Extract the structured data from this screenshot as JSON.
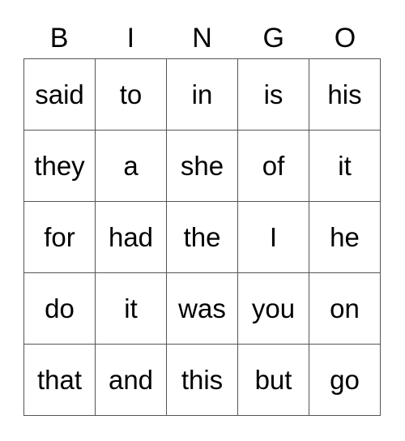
{
  "card": {
    "title": "BINGO",
    "columns": [
      "B",
      "I",
      "N",
      "G",
      "O"
    ],
    "grid": [
      [
        "said",
        "to",
        "in",
        "is",
        "his"
      ],
      [
        "they",
        "a",
        "she",
        "of",
        "it"
      ],
      [
        "for",
        "had",
        "the",
        "I",
        "he"
      ],
      [
        "do",
        "it",
        "was",
        "you",
        "on"
      ],
      [
        "that",
        "and",
        "this",
        "but",
        "go"
      ]
    ],
    "colors": {
      "background": "#ffffff",
      "text": "#000000",
      "grid_line": "#555555"
    }
  }
}
